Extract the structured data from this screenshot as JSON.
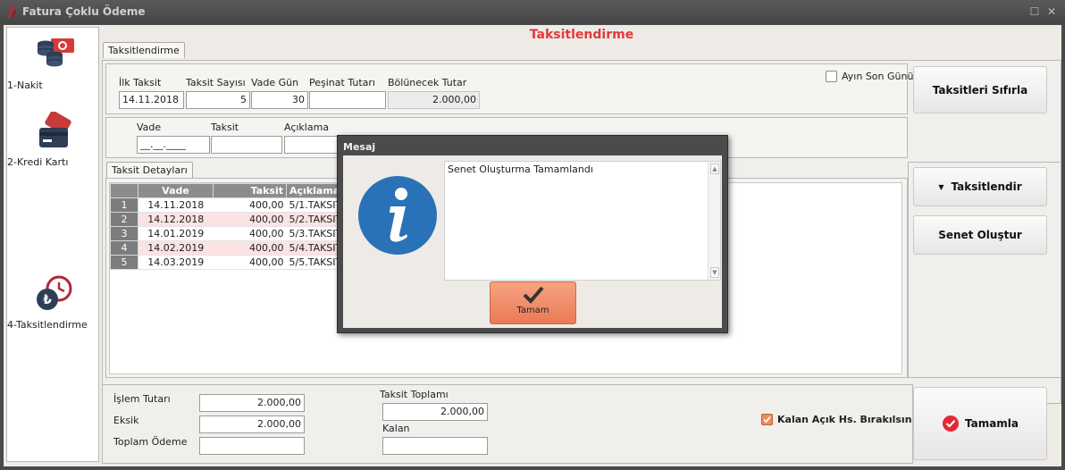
{
  "window": {
    "title": "Fatura Çoklu Ödeme",
    "maximize_glyph": "☐",
    "close_glyph": "✕"
  },
  "sidebar": {
    "items": [
      {
        "label": "1-Nakit",
        "icon": "cash-coins-icon"
      },
      {
        "label": "2-Kredi Kartı",
        "icon": "credit-card-icon"
      },
      {
        "label": "4-Taksitlendirme",
        "icon": "lira-clock-icon"
      }
    ]
  },
  "heading": "Taksitlendirme",
  "top_tab": {
    "label": "Taksitlendirme"
  },
  "installment_form": {
    "ilk_taksit_label": "İlk Taksit",
    "ilk_taksit_value": "14.11.2018",
    "taksit_sayisi_label": "Taksit Sayısı",
    "taksit_sayisi_value": "5",
    "vade_gun_label": "Vade Gün",
    "vade_gun_value": "30",
    "pesinat_label": "Peşinat Tutarı",
    "pesinat_value": "",
    "bolunecek_label": "Bölünecek Tutar",
    "bolunecek_value": "2.000,00",
    "ayin_son_gunu_label": "Ayın Son Günü",
    "reset_button": "Taksitleri Sıfırla"
  },
  "entry_form": {
    "vade_label": "Vade",
    "vade_value": "__.__.____",
    "taksit_label": "Taksit",
    "taksit_value": "",
    "aciklama_label": "Açıklama",
    "aciklama_value": ""
  },
  "details_tab": {
    "label": "Taksit Detayları"
  },
  "details_table": {
    "columns": [
      "",
      "Vade",
      "Taksit",
      "Açıklama"
    ],
    "rows": [
      {
        "no": "1",
        "vade": "14.11.2018",
        "taksit": "400,00",
        "aciklama": "5/1.TAKSIT"
      },
      {
        "no": "2",
        "vade": "14.12.2018",
        "taksit": "400,00",
        "aciklama": "5/2.TAKSIT"
      },
      {
        "no": "3",
        "vade": "14.01.2019",
        "taksit": "400,00",
        "aciklama": "5/3.TAKSIT"
      },
      {
        "no": "4",
        "vade": "14.02.2019",
        "taksit": "400,00",
        "aciklama": "5/4.TAKSIT"
      },
      {
        "no": "5",
        "vade": "14.03.2019",
        "taksit": "400,00",
        "aciklama": "5/5.TAKSIT"
      }
    ]
  },
  "actions": {
    "taksitlendir": "Taksitlendir",
    "senet_olustur": "Senet Oluştur"
  },
  "summary": {
    "islem_tutari_label": "İşlem Tutarı",
    "islem_tutari_value": "2.000,00",
    "eksik_label": "Eksik",
    "eksik_value": "2.000,00",
    "toplam_odeme_label": "Toplam Ödeme",
    "toplam_odeme_value": "",
    "taksit_toplami_label": "Taksit Toplamı",
    "taksit_toplami_value": "2.000,00",
    "kalan_label": "Kalan",
    "kalan_value": "",
    "kalan_acik_label": "Kalan Açık Hs. Bırakılsın",
    "tamamla_button": "Tamamla"
  },
  "dialog": {
    "title": "Mesaj",
    "message": "Senet Oluşturma Tamamlandı",
    "ok_button": "Tamam",
    "icon": "info-icon"
  },
  "colors": {
    "accent_red": "#e03a3a",
    "ok_orange": "#ea7a54",
    "info_blue": "#2a72b8"
  }
}
